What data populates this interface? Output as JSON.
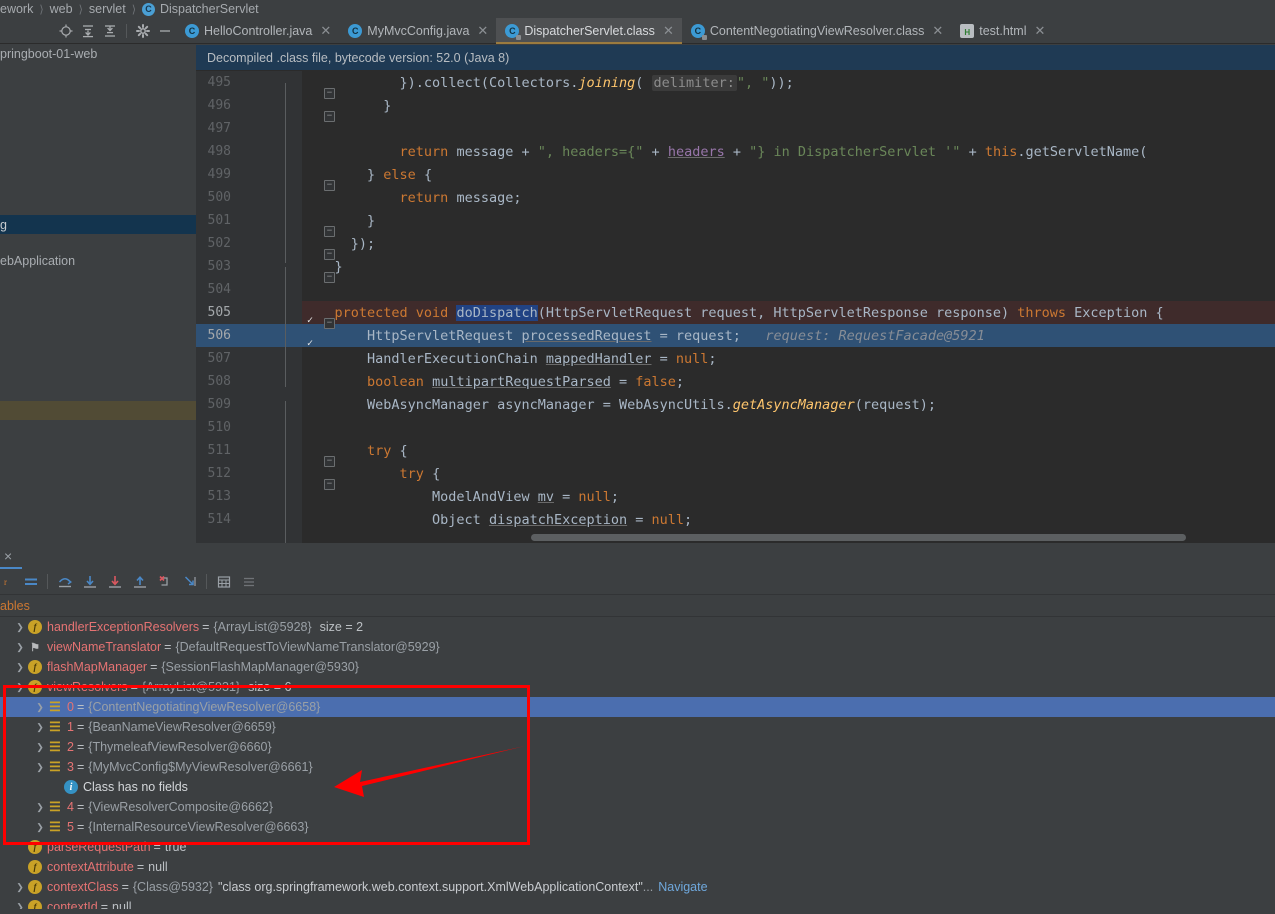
{
  "breadcrumb": {
    "items": [
      "ework",
      "web",
      "servlet"
    ],
    "class_name": "DispatcherServlet",
    "class_icon": "C"
  },
  "project_toolbar": {
    "icons": [
      "locate-target-icon",
      "expand-all-icon",
      "collapse-all-icon",
      "settings-gear-icon",
      "hide-panel-icon"
    ]
  },
  "tabs": [
    {
      "label": "HelloController.java",
      "icon": "java-class-icon",
      "active": false,
      "closable": true
    },
    {
      "label": "MyMvcConfig.java",
      "icon": "java-class-icon",
      "active": false,
      "closable": true
    },
    {
      "label": "DispatcherServlet.class",
      "icon": "java-decompiled-class-icon",
      "active": true,
      "closable": true
    },
    {
      "label": "ContentNegotiatingViewResolver.class",
      "icon": "java-decompiled-class-icon",
      "active": false,
      "closable": true
    },
    {
      "label": "test.html",
      "icon": "html-file-icon",
      "active": false,
      "closable": true
    }
  ],
  "project_panel": {
    "rows": [
      {
        "label": "pringboot-01-web",
        "state": "normal"
      },
      {
        "label": "",
        "state": "normal"
      },
      {
        "label": "",
        "state": "normal"
      },
      {
        "label": "",
        "state": "normal"
      },
      {
        "label": "",
        "state": "normal"
      },
      {
        "label": "",
        "state": "normal"
      },
      {
        "label": "",
        "state": "normal"
      },
      {
        "label": "",
        "state": "normal"
      },
      {
        "label": "",
        "state": "normal"
      },
      {
        "label": "g",
        "state": "selected"
      },
      {
        "label": "",
        "state": "normal"
      },
      {
        "label": "ebApplication",
        "state": "normal"
      },
      {
        "label": "",
        "state": "normal"
      },
      {
        "label": "",
        "state": "normal"
      },
      {
        "label": "",
        "state": "normal"
      },
      {
        "label": "",
        "state": "normal"
      },
      {
        "label": "",
        "state": "normal"
      },
      {
        "label": "",
        "state": "normal"
      },
      {
        "label": "",
        "state": "normal"
      },
      {
        "label": "",
        "state": "highlighted"
      },
      {
        "label": "",
        "state": "normal"
      }
    ]
  },
  "banner": {
    "text": "Decompiled .class file, bytecode version: 52.0 (Java 8)"
  },
  "editor": {
    "lines": [
      {
        "num": "495",
        "fold": "collapse"
      },
      {
        "num": "496",
        "fold": "collapse"
      },
      {
        "num": "497",
        "fold": ""
      },
      {
        "num": "498",
        "fold": ""
      },
      {
        "num": "499",
        "fold": "collapse"
      },
      {
        "num": "500",
        "fold": ""
      },
      {
        "num": "501",
        "fold": "collapse"
      },
      {
        "num": "502",
        "fold": "collapse"
      },
      {
        "num": "503",
        "fold": "collapse"
      },
      {
        "num": "504",
        "fold": ""
      },
      {
        "num": "505",
        "fold": "collapse",
        "breakpoint": true,
        "bulb": true,
        "method_highlight": true
      },
      {
        "num": "506",
        "fold": "",
        "breakpoint": true,
        "executing": true
      },
      {
        "num": "507",
        "fold": ""
      },
      {
        "num": "508",
        "fold": ""
      },
      {
        "num": "509",
        "fold": ""
      },
      {
        "num": "510",
        "fold": ""
      },
      {
        "num": "511",
        "fold": "collapse"
      },
      {
        "num": "512",
        "fold": "collapse"
      },
      {
        "num": "513",
        "fold": ""
      },
      {
        "num": "514",
        "fold": ""
      }
    ],
    "code": {
      "l495": "}).collect(Collectors.joining( delimiter: \", \"));",
      "l496": "}",
      "l498": "return message + \", headers={\" + headers + \"} in DispatcherServlet '\" + this.getServletName(",
      "l499": "} else {",
      "l500": "return message;",
      "l501": "}",
      "l502": "});",
      "l503": "}",
      "l505": "protected void doDispatch(HttpServletRequest request, HttpServletResponse response) throws Exception {",
      "l506": "HttpServletRequest processedRequest = request;   request: RequestFacade@5921",
      "l507": "HandlerExecutionChain mappedHandler = null;",
      "l508": "boolean multipartRequestParsed = false;",
      "l509": "WebAsyncManager asyncManager = WebAsyncUtils.getAsyncManager(request);",
      "l511": "try {",
      "l512": "try {",
      "l513": "ModelAndView mv = null;",
      "l514": "Object dispatchException = null;"
    },
    "debug_hint": "request: RequestFacade@5921",
    "selected_word": "doDispatch"
  },
  "debugger": {
    "toolbar_icons": [
      "mute-breakpoints-icon",
      "show-execution-point-icon",
      "step-over-icon",
      "step-into-icon",
      "force-step-into-icon",
      "step-out-icon",
      "drop-frame-icon",
      "run-to-cursor-icon",
      "evaluate-expression-icon",
      "settings-icon"
    ],
    "section_title": "ables",
    "tab_close": "×",
    "variables": [
      {
        "indent": 0,
        "twisty": "collapsed",
        "icon": "field-icon",
        "name": "handlerExceptionResolvers",
        "eq": "=",
        "value": "{ArrayList@5928}",
        "extra": "size = 2",
        "extra_kind": "plain"
      },
      {
        "indent": 0,
        "twisty": "collapsed",
        "icon": "interface-icon",
        "name": "viewNameTranslator",
        "eq": "=",
        "value": "{DefaultRequestToViewNameTranslator@5929}"
      },
      {
        "indent": 0,
        "twisty": "collapsed",
        "icon": "field-icon",
        "name": "flashMapManager",
        "eq": "=",
        "value": "{SessionFlashMapManager@5930}"
      },
      {
        "indent": 0,
        "twisty": "expanded",
        "icon": "field-icon",
        "name": "viewResolvers",
        "eq": "=",
        "value": "{ArrayList@5931}",
        "extra": "size = 6",
        "extra_kind": "plain"
      },
      {
        "indent": 1,
        "twisty": "collapsed",
        "icon": "list-element-icon",
        "name": "0",
        "eq": "=",
        "value": "{ContentNegotiatingViewResolver@6658}",
        "selected": true
      },
      {
        "indent": 1,
        "twisty": "collapsed",
        "icon": "list-element-icon",
        "name": "1",
        "eq": "=",
        "value": "{BeanNameViewResolver@6659}"
      },
      {
        "indent": 1,
        "twisty": "collapsed",
        "icon": "list-element-icon",
        "name": "2",
        "eq": "=",
        "value": "{ThymeleafViewResolver@6660}"
      },
      {
        "indent": 1,
        "twisty": "expanded",
        "icon": "list-element-icon",
        "name": "3",
        "eq": "=",
        "value": "{MyMvcConfig$MyViewResolver@6661}"
      },
      {
        "indent": 2,
        "twisty": "none",
        "icon": "info-icon",
        "info_text": "Class has no fields"
      },
      {
        "indent": 1,
        "twisty": "collapsed",
        "icon": "list-element-icon",
        "name": "4",
        "eq": "=",
        "value": "{ViewResolverComposite@6662}"
      },
      {
        "indent": 1,
        "twisty": "collapsed",
        "icon": "list-element-icon",
        "name": "5",
        "eq": "=",
        "value": "{InternalResourceViewResolver@6663}"
      },
      {
        "indent": 0,
        "twisty": "none",
        "icon": "field-icon",
        "name": "parseRequestPath",
        "eq": "=",
        "value": "true",
        "value_kind": "literal"
      },
      {
        "indent": 0,
        "twisty": "none",
        "icon": "field-icon",
        "name": "contextAttribute",
        "eq": "=",
        "value": "null",
        "value_kind": "literal"
      },
      {
        "indent": 0,
        "twisty": "collapsed",
        "icon": "field-icon",
        "name": "contextClass",
        "eq": "=",
        "value": "{Class@5932}",
        "string_val": "\"class org.springframework.web.context.support.XmlWebApplicationContext\"",
        "ellipsis": "...",
        "link": "Navigate"
      },
      {
        "indent": 0,
        "twisty": "collapsed",
        "icon": "field-icon",
        "name": "contextId",
        "eq": "=",
        "value": "null",
        "value_kind": "literal"
      }
    ]
  },
  "annotations": {
    "box_color": "#ff0000",
    "arrow_color": "#ff0000",
    "arrow_label": "points-to-MyViewResolver-row"
  },
  "colors": {
    "editor_bg": "#2b2b2b",
    "panel_bg": "#3c3f41",
    "selection_blue": "#4b6eaf",
    "exec_line": "#2f5175",
    "accent_orange": "#cc7832",
    "string_green": "#6a8759",
    "annotation_red": "#ff0000"
  }
}
